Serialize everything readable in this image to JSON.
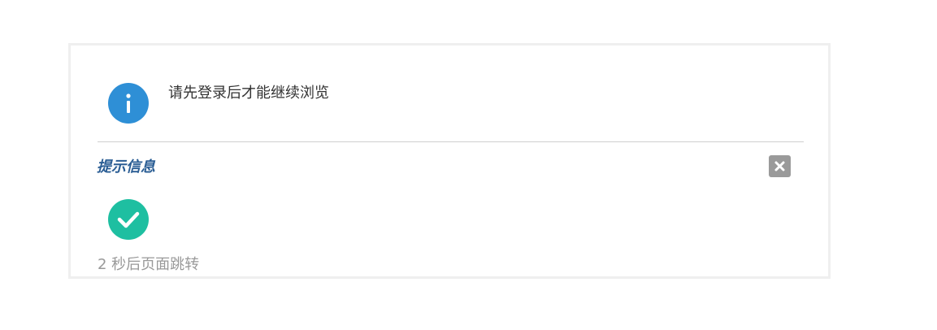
{
  "notice": {
    "icon": "info-icon",
    "message": "请先登录后才能继续浏览",
    "icon_color": "#2e8fd6"
  },
  "dialog": {
    "title": "提示信息",
    "title_color": "#2a5d94",
    "close_icon": "close-icon",
    "success_icon": "check-icon",
    "success_color": "#1ebfa1",
    "redirect_text": "2 秒后页面跳转"
  }
}
